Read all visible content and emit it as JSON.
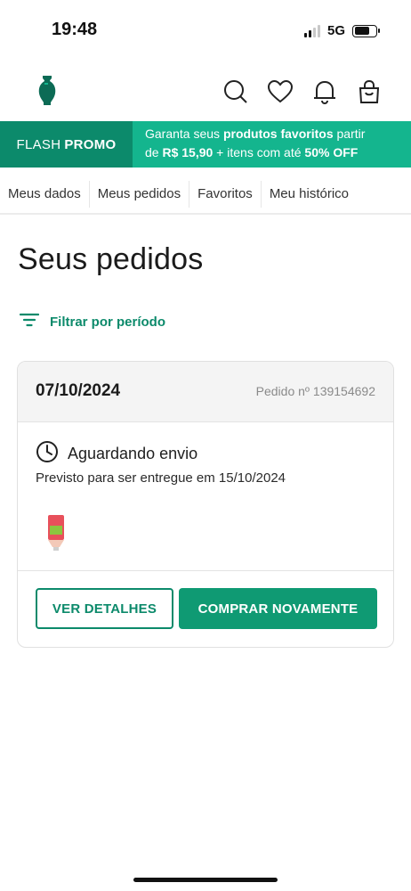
{
  "status_bar": {
    "time": "19:48",
    "network": "5G"
  },
  "header": {
    "logo_icon": "vase-logo-icon",
    "icons": [
      "search-icon",
      "heart-icon",
      "bell-icon",
      "bag-icon"
    ]
  },
  "promo": {
    "left_prefix": "FLASH",
    "left_bold": "PROMO",
    "line1_a": "Garanta seus ",
    "line1_b": "produtos favoritos",
    "line1_c": " partir",
    "line2_a": "de ",
    "line2_b": "R$ 15,90",
    "line2_c": " + itens com até ",
    "line2_d": "50% OFF"
  },
  "tabs": [
    {
      "label": "Meus dados"
    },
    {
      "label": "Meus pedidos"
    },
    {
      "label": "Favoritos"
    },
    {
      "label": "Meu histórico"
    }
  ],
  "page_title": "Seus pedidos",
  "filter": {
    "label": "Filtrar por período"
  },
  "order": {
    "date": "07/10/2024",
    "number": "Pedido nº 139154692",
    "status": "Aguardando envio",
    "delivery": "Previsto para ser entregue em 15/10/2024",
    "details_button": "VER DETALHES",
    "buy_again_button": "COMPRAR NOVAMENTE"
  },
  "colors": {
    "brand_dark": "#0c8a6b",
    "brand_light": "#14b58e",
    "button": "#0f9a73"
  }
}
